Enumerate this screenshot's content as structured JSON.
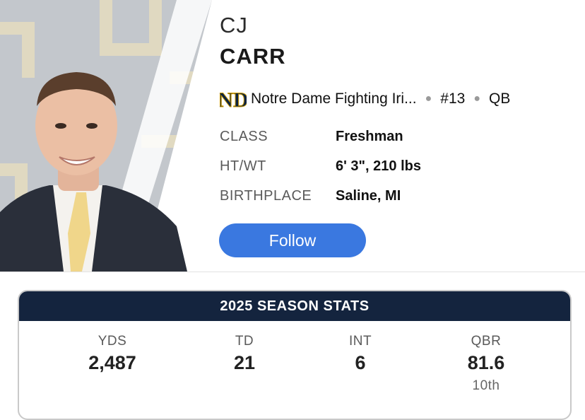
{
  "player": {
    "first_name": "CJ",
    "last_name": "CARR",
    "team": "Notre Dame Fighting Iri...",
    "number": "#13",
    "position": "QB",
    "team_logo_icon": "notre-dame-logo-icon",
    "photo": "player-headshot"
  },
  "info": {
    "class_label": "CLASS",
    "class_value": "Freshman",
    "htwt_label": "HT/WT",
    "htwt_value": "6' 3\", 210 lbs",
    "birthplace_label": "BIRTHPLACE",
    "birthplace_value": "Saline, MI"
  },
  "follow": {
    "label": "Follow"
  },
  "stats": {
    "title": "2025 SEASON STATS",
    "items": [
      {
        "label": "YDS",
        "value": "2,487",
        "rank": ""
      },
      {
        "label": "TD",
        "value": "21",
        "rank": ""
      },
      {
        "label": "INT",
        "value": "6",
        "rank": ""
      },
      {
        "label": "QBR",
        "value": "81.6",
        "rank": "10th"
      }
    ]
  },
  "colors": {
    "follow_button": "#3a78e0",
    "stats_header": "#14243e",
    "team_navy": "#0c2340",
    "team_gold": "#c99700"
  }
}
